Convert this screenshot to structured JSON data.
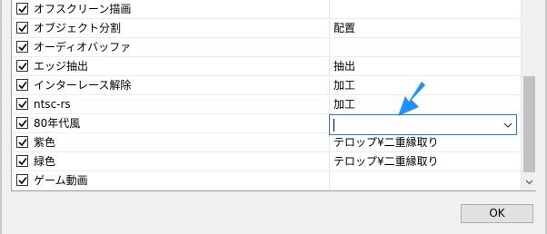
{
  "rows": [
    {
      "name": "オフスクリーン描画",
      "value": "",
      "checked": true
    },
    {
      "name": "オブジェクト分割",
      "value": "配置",
      "checked": true
    },
    {
      "name": "オーディオバッファ",
      "value": "",
      "checked": true
    },
    {
      "name": "エッジ抽出",
      "value": "抽出",
      "checked": true
    },
    {
      "name": "インターレース解除",
      "value": "加工",
      "checked": true
    },
    {
      "name": "ntsc-rs",
      "value": "加工",
      "checked": true
    },
    {
      "name": "80年代風",
      "value": "",
      "checked": true
    },
    {
      "name": "紫色",
      "value": "テロップ¥二重縁取り",
      "checked": true
    },
    {
      "name": "緑色",
      "value": "テロップ¥二重縁取り",
      "checked": true
    },
    {
      "name": "ゲーム動画",
      "value": "",
      "checked": true
    }
  ],
  "editing_row_index": 6,
  "edit_combo": {
    "value": ""
  },
  "buttons": {
    "ok_label": "OK"
  },
  "colors": {
    "focus_border": "#2b7bd6",
    "pointer_arrow": "#1e90ff"
  },
  "icons": {
    "checkbox": "checkmark-icon",
    "dropdown": "chevron-down-icon",
    "scroll_down": "scroll-down-arrow-icon",
    "annotation": "arrow-pointer-icon"
  }
}
